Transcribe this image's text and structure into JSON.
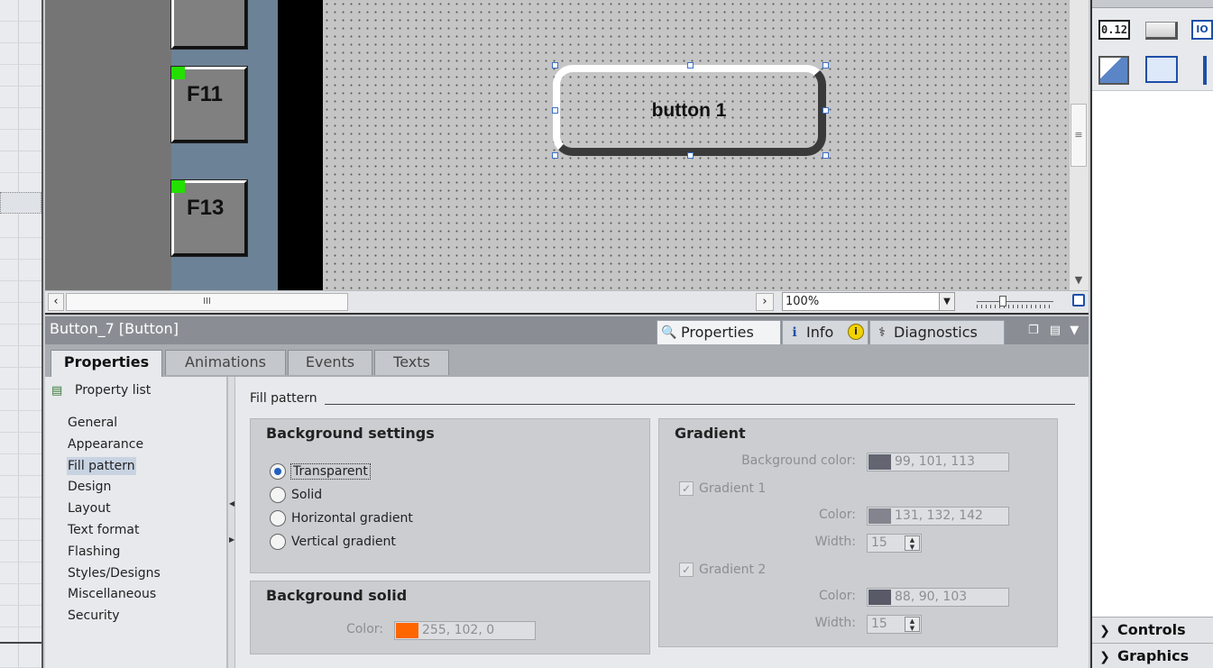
{
  "editor": {
    "fkeys": [
      {
        "label": "F11"
      },
      {
        "label": "F13"
      }
    ],
    "button_text": "button 1",
    "zoom": "100%",
    "hscroll_grip": "III",
    "vscroll_grip": "≡"
  },
  "inspector": {
    "title": "Button_7 [Button]",
    "tabs": [
      {
        "label": "Properties",
        "icon": "properties-icon"
      },
      {
        "label": "Info",
        "icon": "info-icon"
      },
      {
        "label": "Diagnostics",
        "icon": "diagnostics-icon"
      }
    ],
    "info_badge": "i",
    "subtabs": [
      "Properties",
      "Animations",
      "Events",
      "Texts"
    ],
    "nav_header": "Property list",
    "nav_items": [
      "General",
      "Appearance",
      "Fill pattern",
      "Design",
      "Layout",
      "Text format",
      "Flashing",
      "Styles/Designs",
      "Miscellaneous",
      "Security"
    ],
    "selected_nav": "Fill pattern",
    "section_title": "Fill pattern"
  },
  "background_settings": {
    "title": "Background settings",
    "options": [
      "Transparent",
      "Solid",
      "Horizontal gradient",
      "Vertical gradient"
    ],
    "selected": "Transparent"
  },
  "background_solid": {
    "title": "Background solid",
    "color_label": "Color:",
    "color_value": "255, 102, 0",
    "color_hex": "#ff6600"
  },
  "gradient": {
    "title": "Gradient",
    "bg_color_label": "Background color:",
    "bg_color_value": "99, 101, 113",
    "bg_color_hex": "#636571",
    "gradient1_label": "Gradient 1",
    "gradient1_checked": true,
    "color1_label": "Color:",
    "color1_value": "131, 132, 142",
    "color1_hex": "#83848e",
    "width1_label": "Width:",
    "width1_value": "15",
    "gradient2_label": "Gradient 2",
    "gradient2_checked": true,
    "color2_label": "Color:",
    "color2_value": "88, 90, 103",
    "color2_hex": "#585a67",
    "width2_label": "Width:",
    "width2_value": "15"
  },
  "task_panel": {
    "elements_icons": [
      {
        "name": "io-field-icon",
        "text": "0.12"
      },
      {
        "name": "button-element-icon",
        "text": ""
      },
      {
        "name": "symbolic-io-field-icon",
        "text": "IO"
      },
      {
        "name": "graphic-io-field-icon",
        "text": ""
      },
      {
        "name": "date-time-field-icon",
        "text": ""
      },
      {
        "name": "bar-element-icon",
        "text": ""
      }
    ],
    "sections": [
      "Controls",
      "Graphics"
    ]
  }
}
